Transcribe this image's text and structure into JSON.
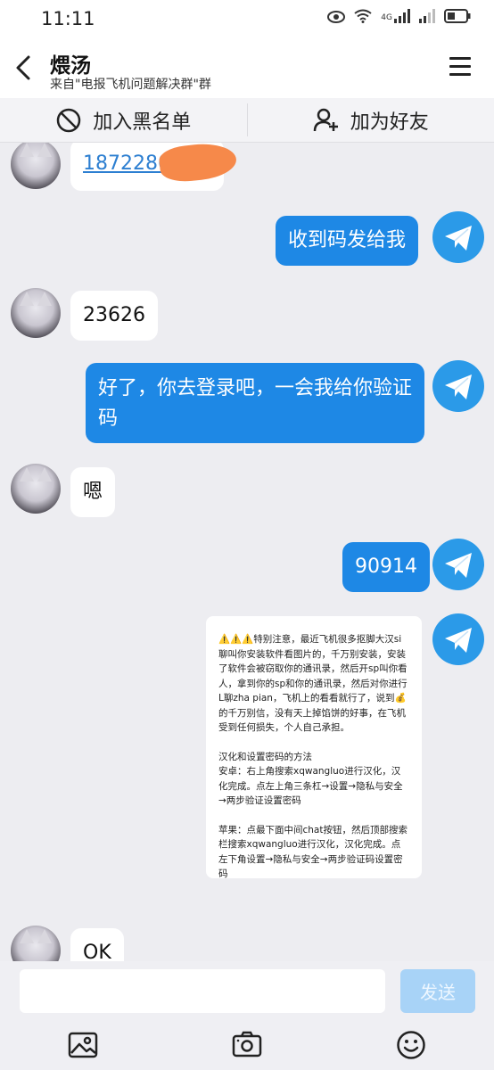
{
  "status_bar": {
    "time": "11:11",
    "network": "4G"
  },
  "header": {
    "title": "煨汤",
    "subtitle": "来自\"电报飞机问题解决群\"群"
  },
  "actions": {
    "block_label": "加入黑名单",
    "add_friend_label": "加为好友"
  },
  "messages": [
    {
      "side": "in",
      "text": "1872280"
    },
    {
      "side": "out",
      "text": "收到码发给我"
    },
    {
      "side": "in",
      "text": "23626"
    },
    {
      "side": "out",
      "text": "好了，你去登录吧，一会我给你验证码"
    },
    {
      "side": "in",
      "text": "嗯"
    },
    {
      "side": "out",
      "text": "90914"
    },
    {
      "side": "out",
      "type": "notice",
      "paragraphs": [
        "⚠️⚠️⚠️特别注意，最近飞机很多抠脚大汉si聊叫你安装软件看图片的，千万别安装，安装了软件会被窃取你的通讯录，然后开sp叫你看人，拿到你的sp和你的通讯录，然后对你进行L聊zha pian，飞机上的看看就行了，说到💰的千万别信，没有天上掉馅饼的好事，在飞机受到任何损失，个人自己承担。",
        "汉化和设置密码的方法\n安卓：右上角搜索xqwangluo进行汉化，汉化完成。点左上角三条杠→设置→隐私与安全→两步验证设置密码",
        "苹果：点最下面中间chat按钮，然后顶部搜索栏搜索xqwangluo进行汉化，汉化完成。点左下角设置→隐私与安全→两步验证码设置密码"
      ]
    },
    {
      "side": "in",
      "text": "OK"
    }
  ],
  "input": {
    "placeholder": "",
    "send_label": "发送"
  },
  "colors": {
    "accent": "#1e88e5",
    "send_disabled": "#a8d3f7",
    "background": "#ededf1"
  },
  "icons": [
    "back-arrow-icon",
    "menu-icon",
    "block-icon",
    "add-person-icon",
    "paper-plane-icon",
    "image-icon",
    "camera-icon",
    "emoji-icon"
  ]
}
